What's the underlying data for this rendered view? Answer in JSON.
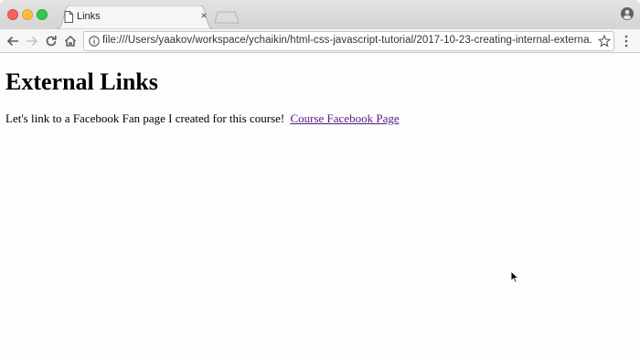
{
  "browser": {
    "tab": {
      "title": "Links",
      "close_glyph": "×"
    },
    "address_bar": {
      "url": "file:///Users/yaakov/workspace/ychaikin/html-css-javascript-tutorial/2017-10-23-creating-internal-externa..."
    },
    "icons": [
      "back-icon",
      "forward-icon",
      "reload-icon",
      "home-icon",
      "info-icon",
      "star-icon",
      "menu-icon",
      "profile-icon",
      "page-icon"
    ]
  },
  "page": {
    "heading": "External Links",
    "paragraph_text": "Let's link to a Facebook Fan page I created for this course!",
    "link_text": "Course Facebook Page"
  },
  "colors": {
    "visited_link": "#551a8b",
    "close_button": "#fc605c",
    "minimize_button": "#fdbc40",
    "maximize_button": "#34c84a"
  }
}
